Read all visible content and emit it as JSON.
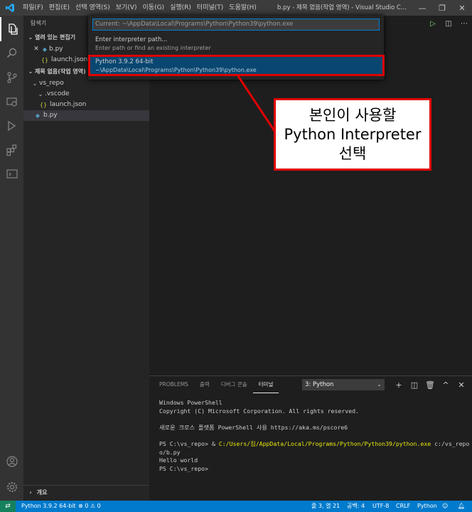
{
  "titlebar": {
    "menu": [
      "파일(F)",
      "편집(E)",
      "선택 영역(S)",
      "보기(V)",
      "이동(G)",
      "실행(R)",
      "터미널(T)",
      "도움말(H)"
    ],
    "window_title": "b.py - 제목 없음(작업 영역) - Visual Studio C..."
  },
  "sidebar": {
    "title": "탐색기",
    "open_editors_header": "열려 있는 편집기",
    "open_editors": [
      "b.py",
      "launch.json ."
    ],
    "workspace_header": "제목 없음(작업 영역)",
    "tree": [
      "vs_repo",
      ".vscode",
      "launch.json",
      "b.py"
    ],
    "outline_header": "개요"
  },
  "quickpick": {
    "input_value": "Current: ~\\AppData\\Local\\Programs\\Python\\Python39\\python.exe",
    "items": [
      {
        "label": "Enter interpreter path...",
        "detail": "Enter path or find an existing interpreter"
      },
      {
        "label": "Python 3.9.2 64-bit",
        "detail": "~\\AppData\\Local\\Programs\\Python\\Python39\\python.exe"
      }
    ]
  },
  "annotation": {
    "lines": [
      "본인이 사용할",
      "Python Interpreter",
      "선택"
    ],
    "color": "#e00000"
  },
  "panel": {
    "tabs": [
      "PROBLEMS",
      "출력",
      "디버그 콘솔",
      "터미널"
    ],
    "active_tab": "터미널",
    "terminal_select": "3: Python",
    "terminal": {
      "l1": "Windows PowerShell",
      "l2": "Copyright (C) Microsoft Corporation. All rights reserved.",
      "l3": "새로운 크로스 플랫폼 PowerShell 사용 https://aka.ms/pscore6",
      "prompt1": "PS C:\\vs_repo> & ",
      "cmd_path": "C:/Users/집/AppData/Local/Programs/Python/Python39/python.exe",
      "cmd_arg": " c:/vs_repo",
      "l5": "o/b.py",
      "l6": "Hello world",
      "l7": "PS C:\\vs_repo>"
    }
  },
  "statusbar": {
    "interpreter": "Python 3.9.2 64-bit",
    "problems": "⊗ 0 ⚠ 0",
    "cursor": "줄 3, 열 21",
    "spaces": "공백: 4",
    "encoding": "UTF-8",
    "eol": "CRLF",
    "language": "Python",
    "accent_color": "#007acc"
  }
}
